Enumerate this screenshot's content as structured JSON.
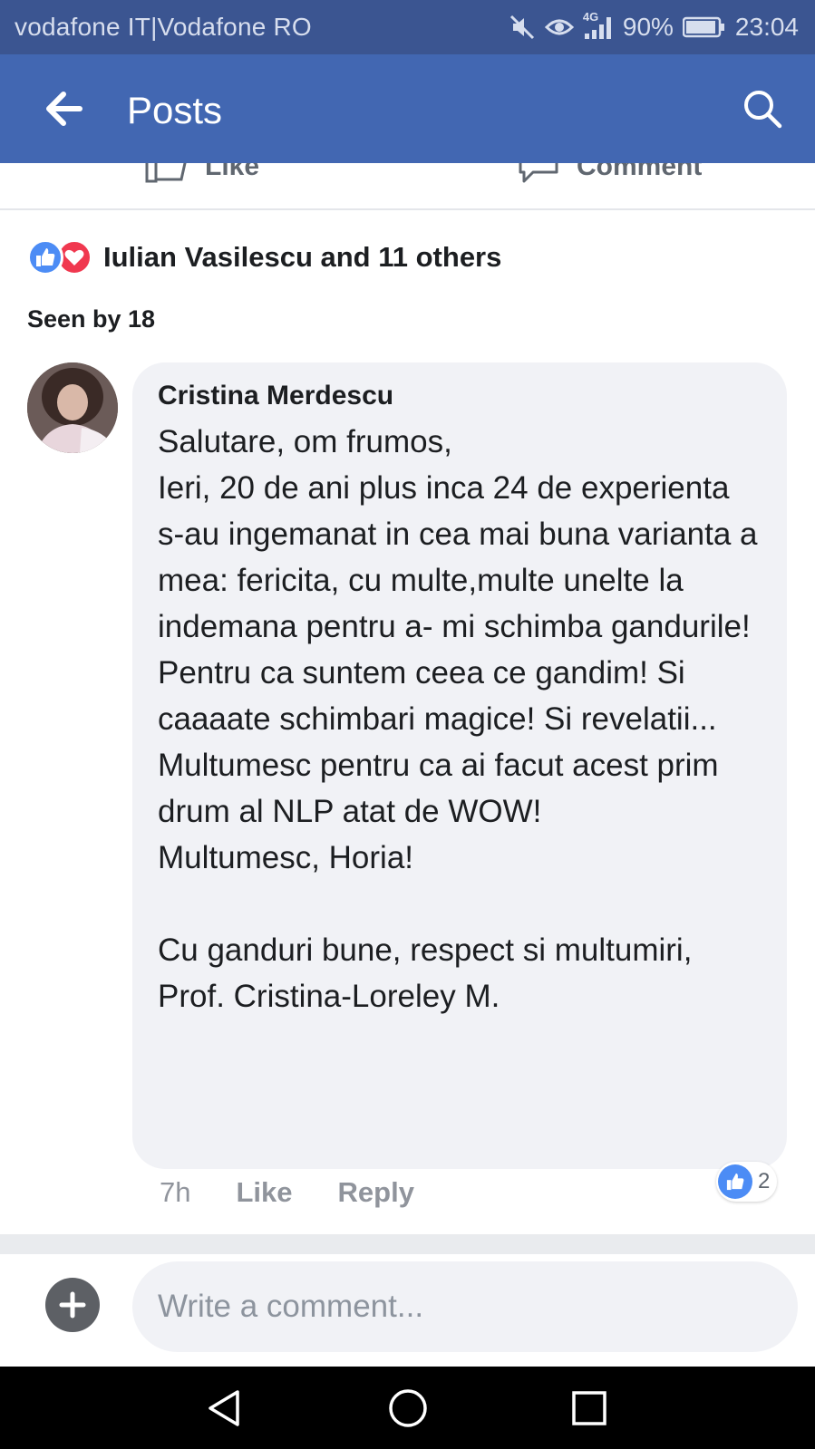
{
  "status_bar": {
    "carrier": "vodafone IT|Vodafone RO",
    "network": "4G",
    "battery": "90%",
    "time": "23:04",
    "icons": [
      "mute-icon",
      "eye-icon",
      "signal-icon",
      "battery-icon"
    ]
  },
  "app_bar": {
    "title": "Posts",
    "back_icon": "arrow-left-icon",
    "search_icon": "search-icon",
    "color": "#4267b2"
  },
  "post_actions": {
    "like_label": "Like",
    "comment_label": "Comment"
  },
  "reactions": {
    "summary": "Iulian Vasilescu and 11 others",
    "icons": [
      "like-reaction-icon",
      "love-reaction-icon"
    ]
  },
  "seen": "Seen by 18",
  "comment": {
    "author": "Cristina Merdescu",
    "text": "Salutare, om frumos,\nIeri, 20 de ani plus inca 24 de experienta s-au ingemanat in cea mai buna varianta a mea: fericita, cu multe,multe unelte la indemana pentru a- mi schimba gandurile!\nPentru ca suntem ceea ce gandim! Si caaaate schimbari magice! Si revelatii...\nMultumesc pentru ca ai facut acest prim drum al NLP atat de WOW!\nMultumesc, Horia!\n\nCu ganduri bune, respect si multumiri,\nProf. Cristina-Loreley M.",
    "time": "7h",
    "like_label": "Like",
    "reply_label": "Reply",
    "like_count": "2"
  },
  "composer": {
    "placeholder": "Write a comment..."
  },
  "nav": {
    "icons": [
      "back-triangle-icon",
      "home-circle-icon",
      "recents-square-icon"
    ]
  }
}
